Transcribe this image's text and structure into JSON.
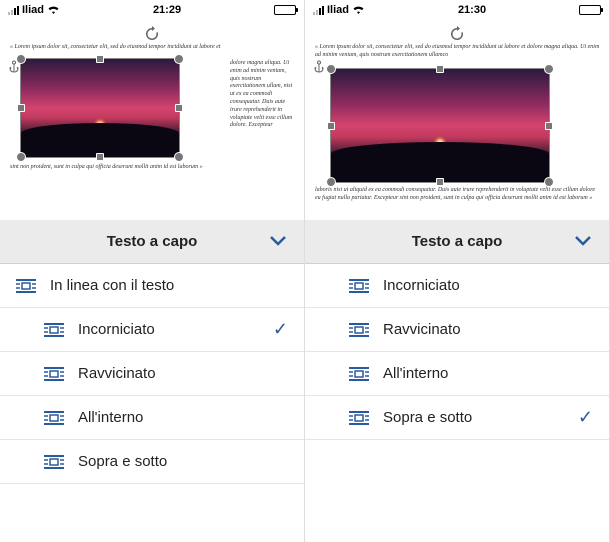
{
  "left": {
    "status": {
      "carrier": "Iliad",
      "time": "21:29"
    },
    "doc_text_top": "« Lorem ipsum dolor sit, consectetur elit, sed do eiusmod tempor incididunt ut labore et",
    "doc_text_right": "dolore magna aliqua. Ut enim ad minim veniam, quis nostrum exercitationem ullam, nisi ut ex ea commodi consequatur. Duis aute irure reprehenderit in voluptate velit esse cillum dolore. Excepteur",
    "doc_text_bottom": "sint non proident, sunt in culpa qui officia deserunt mollit anim id est laborum »",
    "panel_title": "Testo a capo",
    "options": [
      {
        "label": "In linea con il testo",
        "selected": false,
        "indent": false
      },
      {
        "label": "Incorniciato",
        "selected": true,
        "indent": true
      },
      {
        "label": "Ravvicinato",
        "selected": false,
        "indent": true
      },
      {
        "label": "All'interno",
        "selected": false,
        "indent": true
      },
      {
        "label": "Sopra e sotto",
        "selected": false,
        "indent": true
      }
    ]
  },
  "right": {
    "status": {
      "carrier": "Iliad",
      "time": "21:30"
    },
    "doc_text_top": "« Lorem ipsum dolor sit, consectetur elit, sed do eiusmod tempor incididunt ut labore et dolore magna aliqua. Ut enim ad minim veniam, quis nostrum exercitationem ullamco",
    "doc_text_bottom": "laboris nisi ut aliquid ex ea commodi consequatur. Duis aute irure reprehenderit in voluptate velit esse cillum dolore eu fugiat nulla pariatur. Excepteur sint non proident, sunt in culpa qui officia deserunt mollit anim id est laborum »",
    "panel_title": "Testo a capo",
    "options": [
      {
        "label": "Incorniciato",
        "selected": false,
        "indent": true
      },
      {
        "label": "Ravvicinato",
        "selected": false,
        "indent": true
      },
      {
        "label": "All'interno",
        "selected": false,
        "indent": true
      },
      {
        "label": "Sopra e sotto",
        "selected": true,
        "indent": true
      }
    ]
  }
}
